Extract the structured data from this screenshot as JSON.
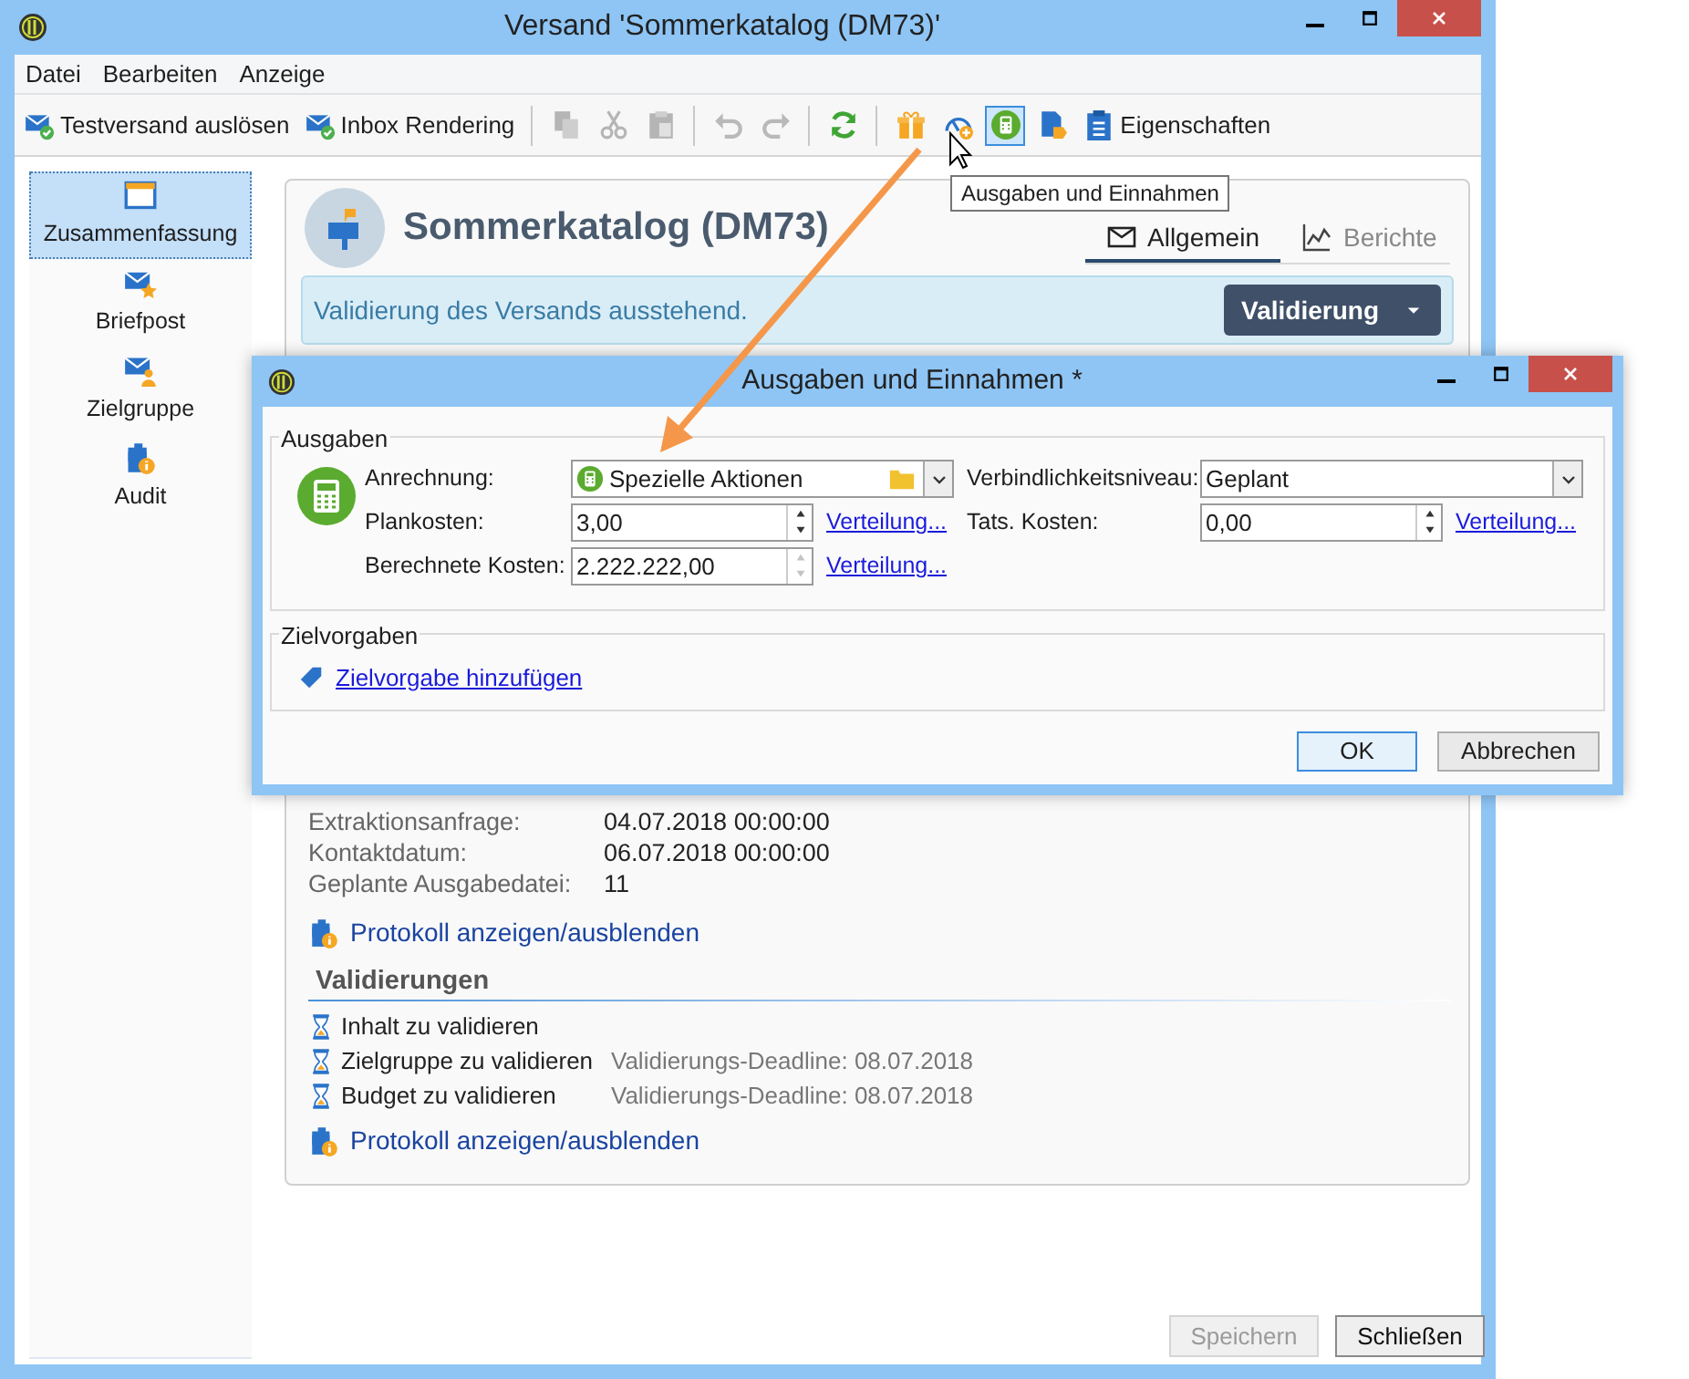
{
  "window": {
    "title": "Versand 'Sommerkatalog (DM73)'"
  },
  "menu": [
    "Datei",
    "Bearbeiten",
    "Anzeige"
  ],
  "toolbar": [
    {
      "kind": "button",
      "label": "Testversand auslösen",
      "disabled": false,
      "active": false
    },
    {
      "kind": "button",
      "label": "Inbox Rendering",
      "disabled": false,
      "active": false
    },
    {
      "kind": "separator"
    },
    {
      "kind": "icon",
      "disabled": true,
      "active": false
    },
    {
      "kind": "icon",
      "disabled": true,
      "active": false
    },
    {
      "kind": "icon",
      "disabled": true,
      "active": false
    },
    {
      "kind": "separator"
    },
    {
      "kind": "icon",
      "disabled": true,
      "active": false
    },
    {
      "kind": "icon",
      "disabled": true,
      "active": false
    },
    {
      "kind": "separator"
    },
    {
      "kind": "icon",
      "disabled": false,
      "active": false
    },
    {
      "kind": "separator"
    },
    {
      "kind": "icon",
      "disabled": false,
      "active": false
    },
    {
      "kind": "icon",
      "disabled": false,
      "active": false
    },
    {
      "kind": "icon",
      "disabled": false,
      "active": true
    },
    {
      "kind": "icon",
      "disabled": false,
      "active": false
    },
    {
      "kind": "button",
      "label": "Eigenschaften",
      "disabled": false,
      "active": false
    }
  ],
  "tooltip": "Ausgaben und Einnahmen",
  "sidebar": [
    {
      "label": "Zusammenfassung",
      "selected": true
    },
    {
      "label": "Briefpost",
      "selected": false
    },
    {
      "label": "Zielgruppe",
      "selected": false
    },
    {
      "label": "Audit",
      "selected": false
    }
  ],
  "panel": {
    "title": "Sommerkatalog (DM73)",
    "tabs": [
      {
        "label": "Allgemein",
        "selected": true
      },
      {
        "label": "Berichte",
        "selected": false
      }
    ],
    "alert": "Validierung des Versands ausstehend.",
    "validate_button": "Validierung",
    "details": [
      {
        "label": "Extraktionsanfrage:",
        "value": "04.07.2018 00:00:00"
      },
      {
        "label": "Kontaktdatum:",
        "value": "06.07.2018 00:00:00"
      },
      {
        "label": "Geplante Ausgabedatei:",
        "value": "11"
      }
    ],
    "log_link": "Protokoll anzeigen/ausblenden",
    "validations_title": "Validierungen",
    "validations": [
      {
        "label": "Inhalt zu validieren"
      },
      {
        "label": "Zielgruppe zu validieren",
        "deadline": "Validierungs-Deadline: 08.07.2018"
      },
      {
        "label": "Budget zu validieren",
        "deadline": "Validierungs-Deadline: 08.07.2018"
      }
    ],
    "log_link_2": "Protokoll anzeigen/ausblenden"
  },
  "footer_buttons": [
    {
      "label": "Speichern",
      "disabled": true
    },
    {
      "label": "Schließen",
      "disabled": false
    }
  ],
  "dialog": {
    "title": "Ausgaben und Einnahmen *",
    "expenses": {
      "title": "Ausgaben",
      "assignment": {
        "label": "Anrechnung:",
        "value": "Spezielle Aktionen"
      },
      "commitment": {
        "label": "Verbindlichkeitsniveau:",
        "value": "Geplant"
      },
      "planned": {
        "label": "Plankosten:",
        "value": "3,00",
        "link": "Verteilung...",
        "disabled": false
      },
      "actual": {
        "label": "Tats. Kosten:",
        "value": "0,00",
        "link": "Verteilung...",
        "disabled": false
      },
      "calculated": {
        "label": "Berechnete Kosten:",
        "value": "2.222.222,00",
        "link": "Verteilung...",
        "disabled": true
      }
    },
    "targets": {
      "title": "Zielvorgaben",
      "link": "Zielvorgabe hinzufügen"
    },
    "buttons": [
      {
        "label": "OK",
        "selected": true
      },
      {
        "label": "Abbrechen",
        "selected": false
      }
    ]
  }
}
